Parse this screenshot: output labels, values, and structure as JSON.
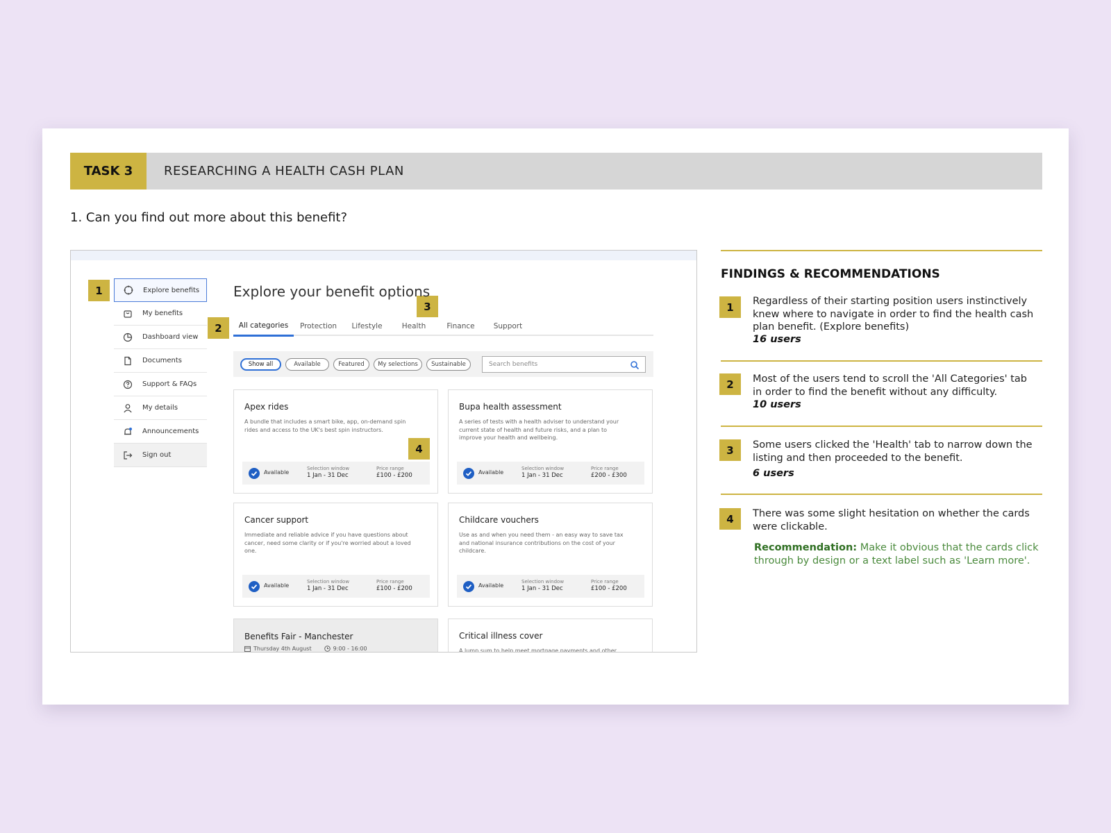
{
  "header": {
    "task_label": "TASK 3",
    "task_title": "RESEARCHING A HEALTH CASH PLAN"
  },
  "question": "1. Can you find out more about this benefit?",
  "badges": [
    "1",
    "2",
    "3",
    "4"
  ],
  "screenshot": {
    "sidenav": [
      {
        "label": "Explore benefits",
        "icon": "compass-icon"
      },
      {
        "label": "My benefits",
        "icon": "bag-icon"
      },
      {
        "label": "Dashboard view",
        "icon": "pie-chart-icon"
      },
      {
        "label": "Documents",
        "icon": "document-icon"
      },
      {
        "label": "Support & FAQs",
        "icon": "help-icon"
      },
      {
        "label": "My details",
        "icon": "user-icon"
      },
      {
        "label": "Announcements",
        "icon": "bell-icon"
      },
      {
        "label": "Sign out",
        "icon": "sign-out-icon"
      }
    ],
    "page_title": "Explore your benefit options",
    "tabs": [
      "All categories",
      "Protection",
      "Lifestyle",
      "Health",
      "Finance",
      "Support"
    ],
    "filters": [
      "Show all",
      "Available",
      "Featured",
      "My selections",
      "Sustainable"
    ],
    "search_placeholder": "Search benefits",
    "foot_labels": {
      "selection_window": "Selection window",
      "price_range": "Price range"
    },
    "cards": [
      {
        "title": "Apex rides",
        "desc": "A bundle that includes a smart bike, app, on-demand spin rides and access to the UK's best spin instructors.",
        "status": "Available",
        "window": "1 Jan - 31 Dec",
        "price": "£100 - £200"
      },
      {
        "title": "Bupa health assessment",
        "desc": "A series of tests with a health adviser to understand your current state of health and future risks, and a plan to improve your health and wellbeing.",
        "status": "Available",
        "window": "1 Jan - 31 Dec",
        "price": "£200 - £300"
      },
      {
        "title": "Cancer support",
        "desc": "Immediate and reliable advice if you have questions about cancer, need some clarity or if you're worried about a loved one.",
        "status": "Available",
        "window": "1 Jan - 31 Dec",
        "price": "£100 - £200"
      },
      {
        "title": "Childcare vouchers",
        "desc": "Use as and when you need them - an easy way to save tax and national insurance contributions on the cost of your childcare.",
        "status": "Available",
        "window": "1 Jan - 31 Dec",
        "price": "£100 - £200"
      },
      {
        "title": "Critical illness cover",
        "desc": "A lump sum to help meet mortgage payments and other"
      }
    ],
    "event_card": {
      "title": "Benefits Fair - Manchester",
      "date": "Thursday 4th August",
      "time": "9:00 - 16:00"
    }
  },
  "findings": {
    "heading": "FINDINGS & RECOMMENDATIONS",
    "items": [
      {
        "num": "1",
        "text": "Regardless of their starting position users instinctively knew where to navigate in order to find the health cash plan benefit. (Explore benefits)",
        "users": "16 users"
      },
      {
        "num": "2",
        "text": "Most of the users tend to scroll the 'All Categories' tab in order to find the benefit without any difficulty.",
        "users": "10 users"
      },
      {
        "num": "3",
        "text": "Some users clicked the 'Health' tab to narrow down the listing and then proceeded to the benefit.",
        "users": "6 users"
      },
      {
        "num": "4",
        "text": "There was some slight hesitation on whether the cards were clickable."
      }
    ],
    "recommendation_label": "Recommendation:",
    "recommendation_text": "Make it obvious that the cards click through by design or a text label such as 'Learn more'."
  },
  "colors": {
    "accent_gold": "#cdb442",
    "link_blue": "#2e6fd6",
    "recommendation_green": "#4a8a3c",
    "background": "#ede3f5"
  }
}
